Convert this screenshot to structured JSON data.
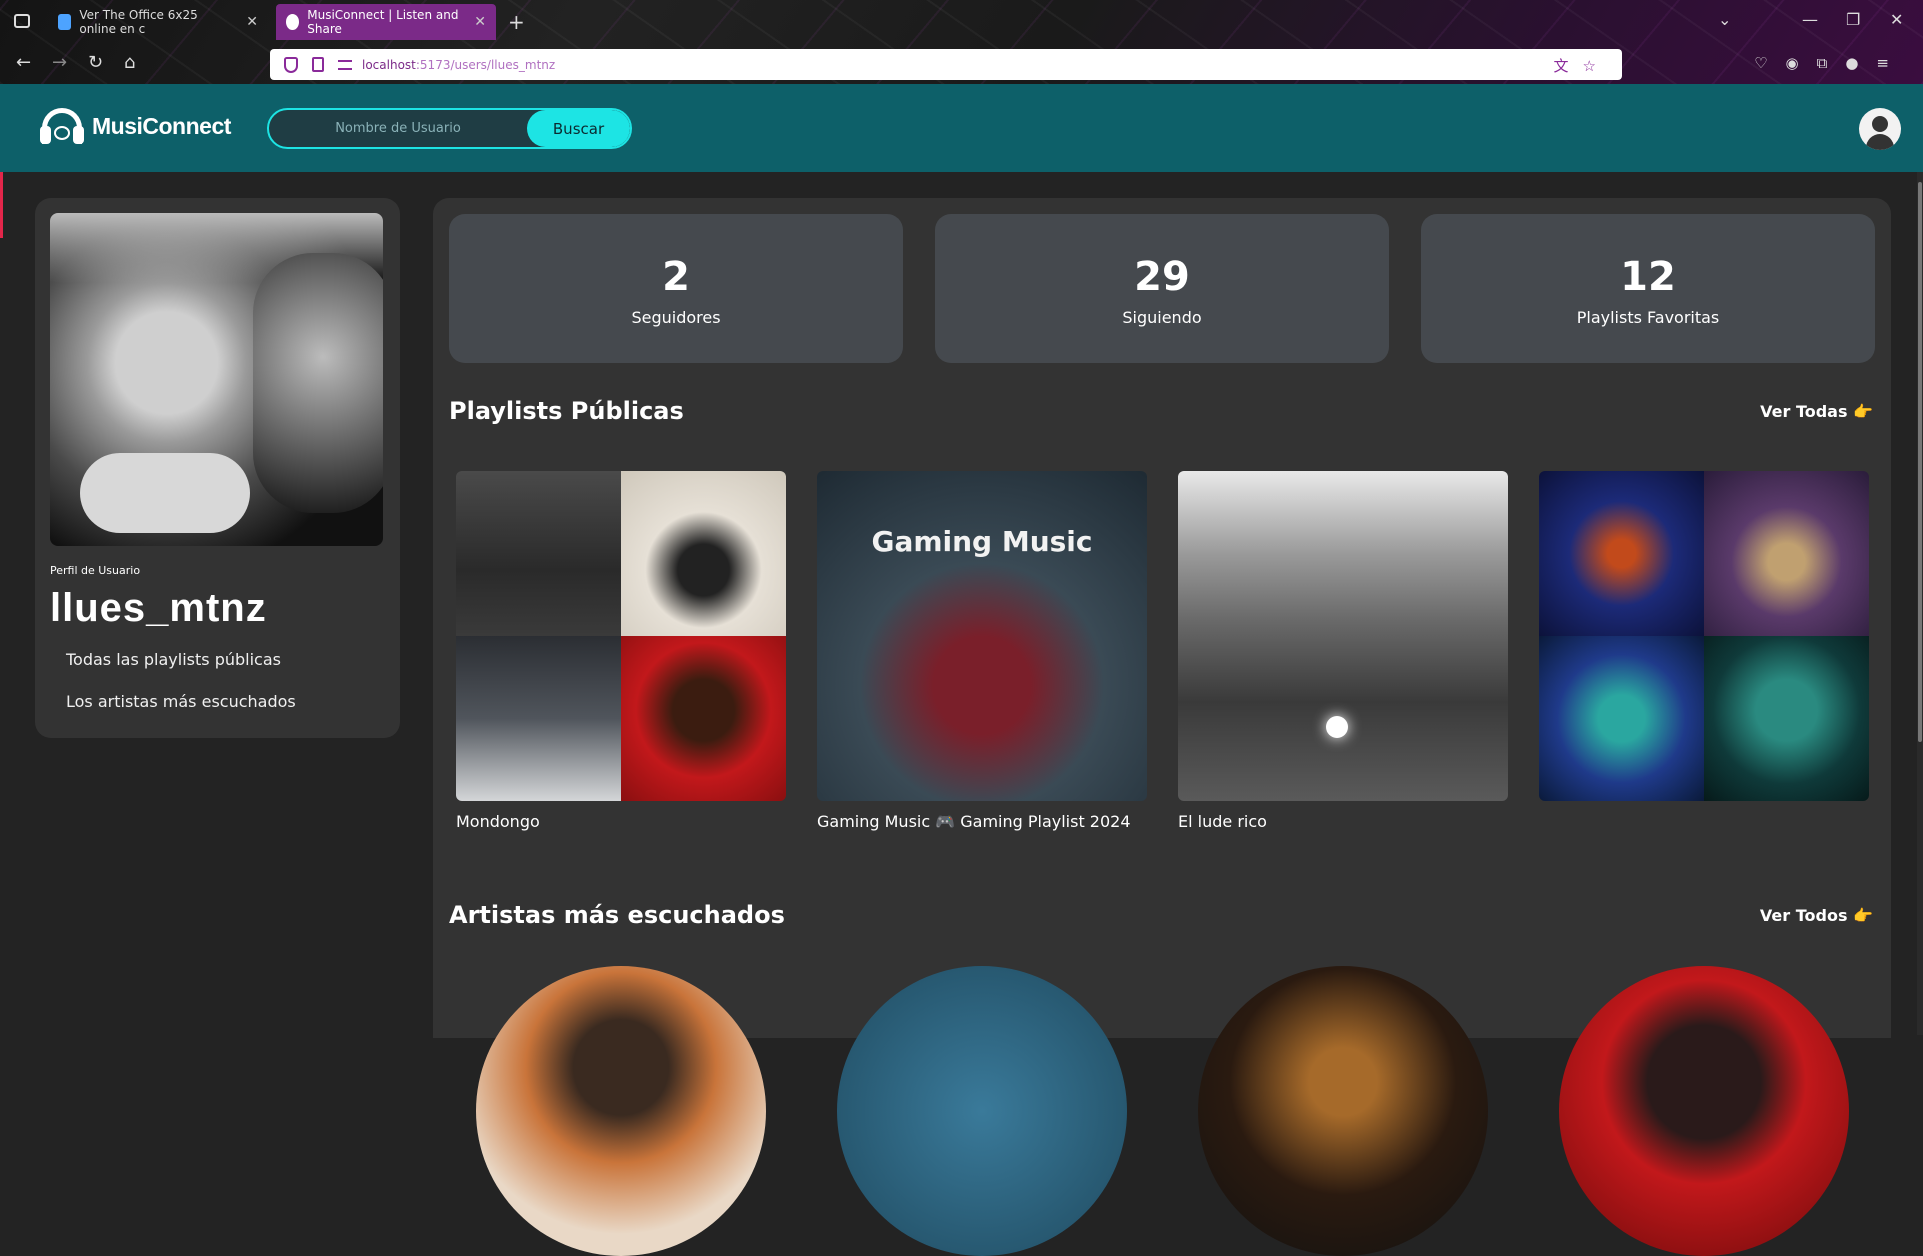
{
  "browser": {
    "tabs": [
      {
        "title": "Ver The Office 6x25 online en c",
        "active": false
      },
      {
        "title": "MusiConnect | Listen and Share",
        "active": true
      }
    ],
    "url": {
      "host": "localhost",
      "path": ":5173/users/llues_mtnz"
    }
  },
  "header": {
    "logo": "MusiConnect",
    "search_placeholder": "Nombre de Usuario",
    "search_button": "Buscar"
  },
  "profile": {
    "label": "Perfil de Usuario",
    "username": "llues_mtnz",
    "links": [
      "Todas las playlists públicas",
      "Los artistas más escuchados"
    ]
  },
  "stats": [
    {
      "value": "2",
      "label": "Seguidores"
    },
    {
      "value": "29",
      "label": "Siguiendo"
    },
    {
      "value": "12",
      "label": "Playlists Favoritas"
    }
  ],
  "playlists_section": {
    "title": "Playlists Públicas",
    "see_all": "Ver Todas",
    "items": [
      {
        "title": "Mondongo"
      },
      {
        "title": "Gaming Music 🎮 Gaming Playlist 2024",
        "cover_text": "Gaming Music"
      },
      {
        "title": "El lude rico"
      },
      {
        "title": ""
      }
    ]
  },
  "artists_section": {
    "title": "Artistas más escuchados",
    "see_all": "Ver Todos"
  },
  "colors": {
    "header_bg": "#0d6069",
    "accent": "#1de4e4",
    "panel_bg": "#333333",
    "stat_bg": "#45494e",
    "page_bg": "#232323"
  },
  "icons": {
    "see_all": "👉"
  }
}
